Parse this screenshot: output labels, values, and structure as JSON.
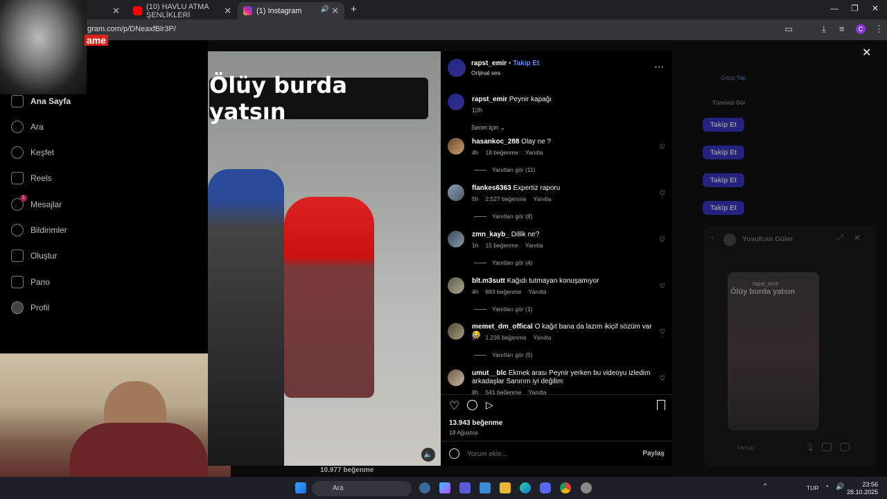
{
  "browser": {
    "tabs": [
      {
        "label": "(10) HAVLU ATMA ŞENLİKLERİ",
        "active": false
      },
      {
        "label": "(1) Instagram",
        "active": true
      }
    ],
    "url": "gram.com/p/DNeaxfBlr3P/",
    "window_controls": [
      "—",
      "❐",
      "✕"
    ]
  },
  "overlay_logo": "ame",
  "sidebar": {
    "items": [
      {
        "label": "Ana Sayfa",
        "icon": "home-icon"
      },
      {
        "label": "Ara",
        "icon": "search-icon"
      },
      {
        "label": "Keşfet",
        "icon": "compass-icon"
      },
      {
        "label": "Reels",
        "icon": "reels-icon"
      },
      {
        "label": "Mesajlar",
        "icon": "messenger-icon",
        "badge": "1"
      },
      {
        "label": "Bildirimler",
        "icon": "heart-icon"
      },
      {
        "label": "Oluştur",
        "icon": "plus-icon"
      },
      {
        "label": "Pano",
        "icon": "chart-icon"
      },
      {
        "label": "Profil",
        "icon": "avatar-icon"
      }
    ]
  },
  "video": {
    "caption": "Ölüy burda yatsın",
    "below_likes": "10.977 beğenme"
  },
  "post": {
    "author": "rapst_emir",
    "follow_label": "Takip Et",
    "audio": "Orijinal ses",
    "caption_user": "rapst_emir",
    "caption_text": "Peynir kapağı",
    "caption_time": "10h",
    "sort_label": "Senin için",
    "likes": "13.943 beğenme",
    "date": "18 Ağustos",
    "comment_placeholder": "Yorum ekle...",
    "share_label": "Paylaş"
  },
  "comments": [
    {
      "user": "hasankoc_288",
      "text": "Olay ne ?",
      "time": "4h",
      "likes": "18 beğenme",
      "reply": "Yanıtla",
      "replies": "Yanıtları gör (11)"
    },
    {
      "user": "flankes6363",
      "text": "Expertiz raporu",
      "time": "5h",
      "likes": "2.527 beğenme",
      "reply": "Yanıtla",
      "replies": "Yanıtları gör (8)"
    },
    {
      "user": "zmn_kayb_",
      "text": "Dillik ne?",
      "time": "1h",
      "likes": "15 beğenme",
      "reply": "Yanıtla",
      "replies": "Yanıtları gör (4)"
    },
    {
      "user": "blt.m3sutt",
      "text": "Kağıdı tutmayan konuşamıyor",
      "time": "4h",
      "likes": "893 beğenme",
      "reply": "Yanıtla",
      "replies": "Yanıtları gör (1)"
    },
    {
      "user": "memet_dm_offical",
      "text": "O kağıt bana da lazım ikiçif sözüm var😂",
      "time": "9h",
      "likes": "1.236 beğenme",
      "reply": "Yanıtla",
      "replies": "Yanıtları gör (5)"
    },
    {
      "user": "umut__blc",
      "text": "Ekmek arası Peynir yerken bu videoyu izledim arkadaşlar Sanırım iyi değilim",
      "time": "8h",
      "likes": "541 beğenme",
      "reply": "Yanıtla",
      "replies": ""
    }
  ],
  "right": {
    "switch": "Geçiş Yap",
    "see_all": "Tümünü Gör",
    "follow_label": "Takip Et",
    "chat_user": "Yusufcan Güler",
    "chat_user2": "rapst_emir",
    "chat_caption": "Ölüy burda yatsın",
    "chat_placeholder": "Mesaj..."
  },
  "taskbar": {
    "search": "Ara",
    "lang": "TUR",
    "time": "23:56",
    "date": "28.10.2025"
  }
}
